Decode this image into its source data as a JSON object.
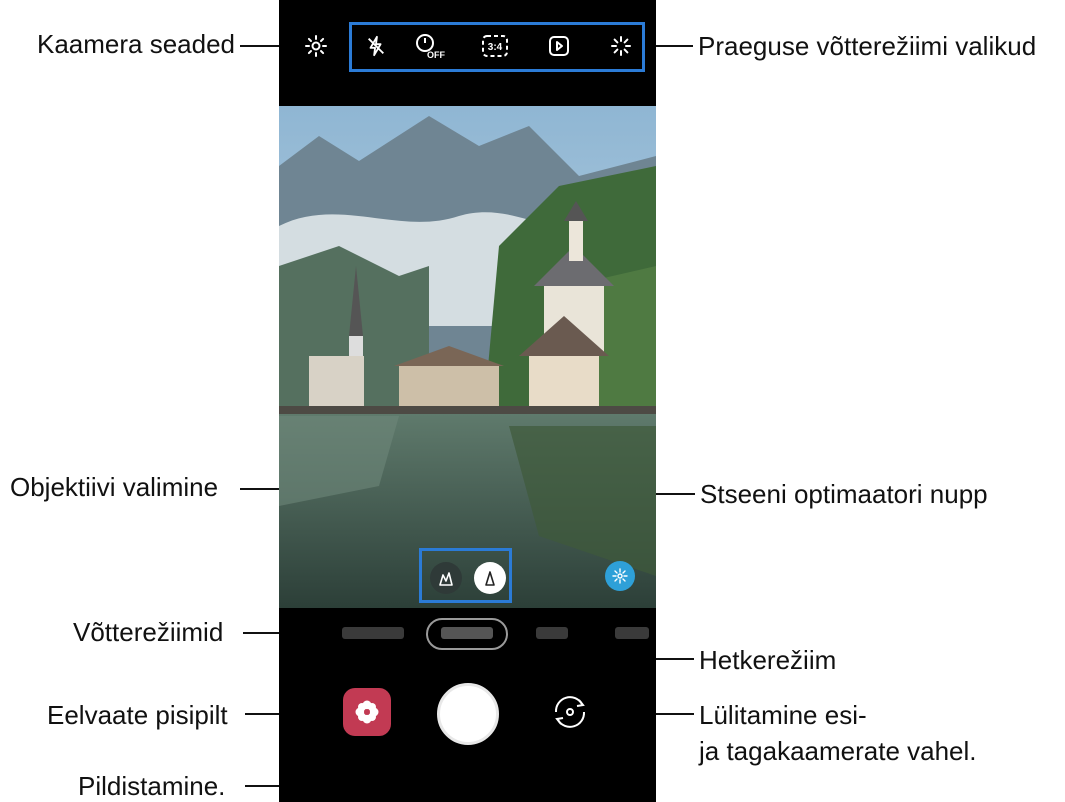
{
  "callouts": {
    "camera_settings": "Kaamera seaded",
    "current_mode_options": "Praeguse võtterežiimi valikud",
    "lens_selection": "Objektiivi valimine",
    "scene_optimizer": "Stseeni optimaatori nupp",
    "shooting_modes": "Võtterežiimid",
    "current_mode": "Hetkerežiim",
    "preview_thumbnail": "Eelvaate pisipilt",
    "switch_cameras_line1": "Lülitamine esi-",
    "switch_cameras_line2": "ja tagakaamerate vahel.",
    "take_picture": "Pildistamine."
  },
  "toolbar": {
    "icons": [
      "settings-icon",
      "flash-off-icon",
      "timer-off-icon",
      "aspect-ratio-icon",
      "motion-photo-icon",
      "filter-icon"
    ],
    "aspect_label": "3:4",
    "timer_label": "OFF"
  },
  "colors": {
    "accent_frame": "#2b7bd6",
    "thumbnail": "#c23a53",
    "scene_button": "#2ea0d8",
    "phone_body": "#000000"
  }
}
